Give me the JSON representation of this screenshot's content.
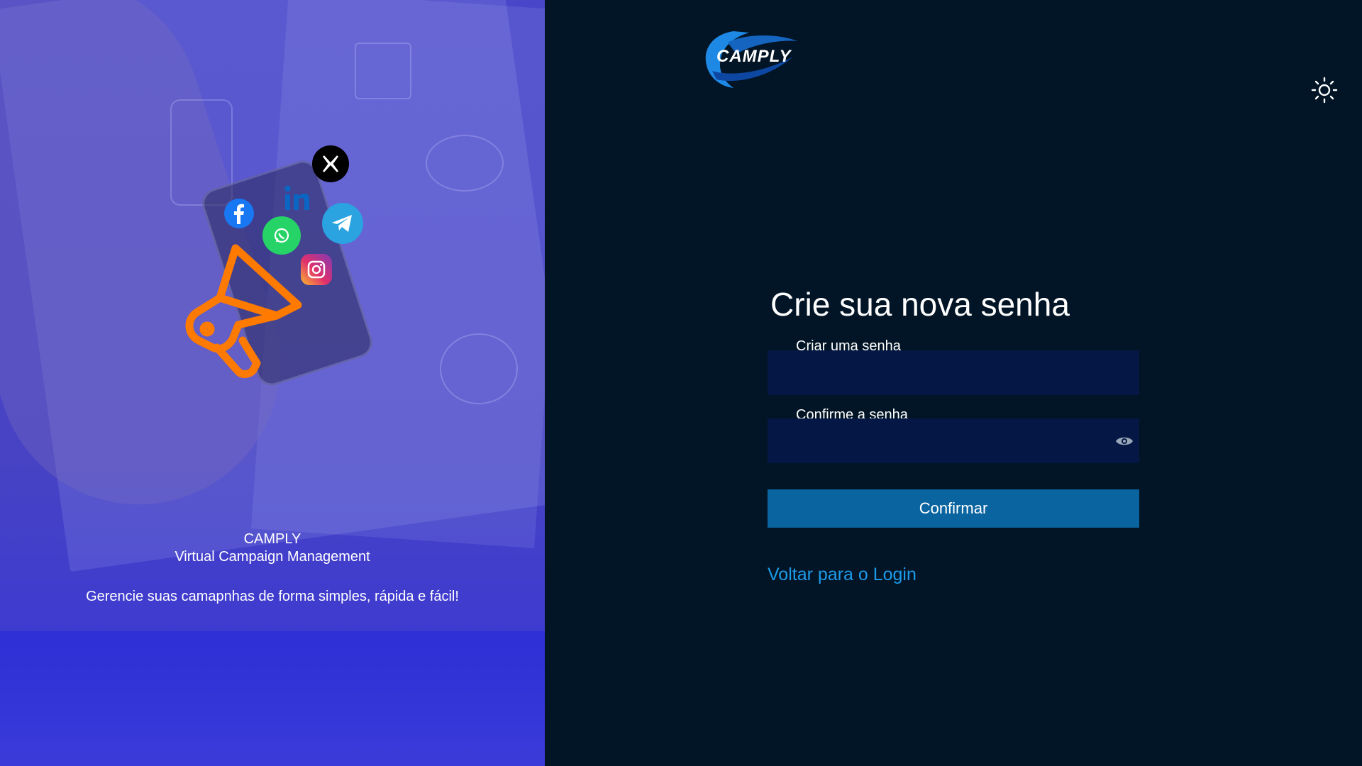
{
  "hero": {
    "brand_name": "CAMPLY",
    "brand_subtitle": "Virtual Campaign Management",
    "tagline": "Gerencie suas camapnhas de forma simples, rápida e fácil!",
    "social_icons": [
      "x-icon",
      "linkedin-icon",
      "facebook-icon",
      "whatsapp-icon",
      "telegram-icon",
      "instagram-icon",
      "megaphone-icon"
    ]
  },
  "logo": {
    "text": "CAMPLY"
  },
  "form": {
    "title": "Crie sua nova senha",
    "password_label": "Criar uma senha",
    "password_value": "",
    "confirm_label": "Confirme a senha",
    "confirm_value": "",
    "confirm_button": "Confirmar",
    "back_link": "Voltar para o Login"
  },
  "theme_toggle_icon": "sun-icon",
  "colors": {
    "background": "#021526",
    "hero_overlay": "#4a46c9",
    "input_bg": "#041745",
    "button_bg": "#0a64a0",
    "link": "#1d9bea",
    "megaphone": "#ff7a00"
  }
}
